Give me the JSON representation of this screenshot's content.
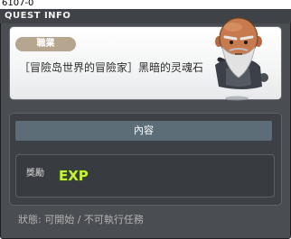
{
  "window": {
    "quest_id": "6107-0",
    "title": "QUEST INFO"
  },
  "header": {
    "category_badge": "職業",
    "quest_name": "［冒險岛世界的冒險家］黑暗的灵魂石",
    "npc_icon": "bearded-npc-portrait"
  },
  "content": {
    "section_title": "內容",
    "reward_label": "獎勵",
    "reward_icon": "exp-icon",
    "reward_icon_text": "EXP"
  },
  "status": {
    "text": "狀態: 可開始 / 不可執行任務"
  },
  "colors": {
    "window_bg": "#4a4d52",
    "panel_border": "#6c7076",
    "badge_bg": "#b6a690",
    "section_header_bg": "#5d6d78",
    "exp_green": "#c9ef3a"
  }
}
